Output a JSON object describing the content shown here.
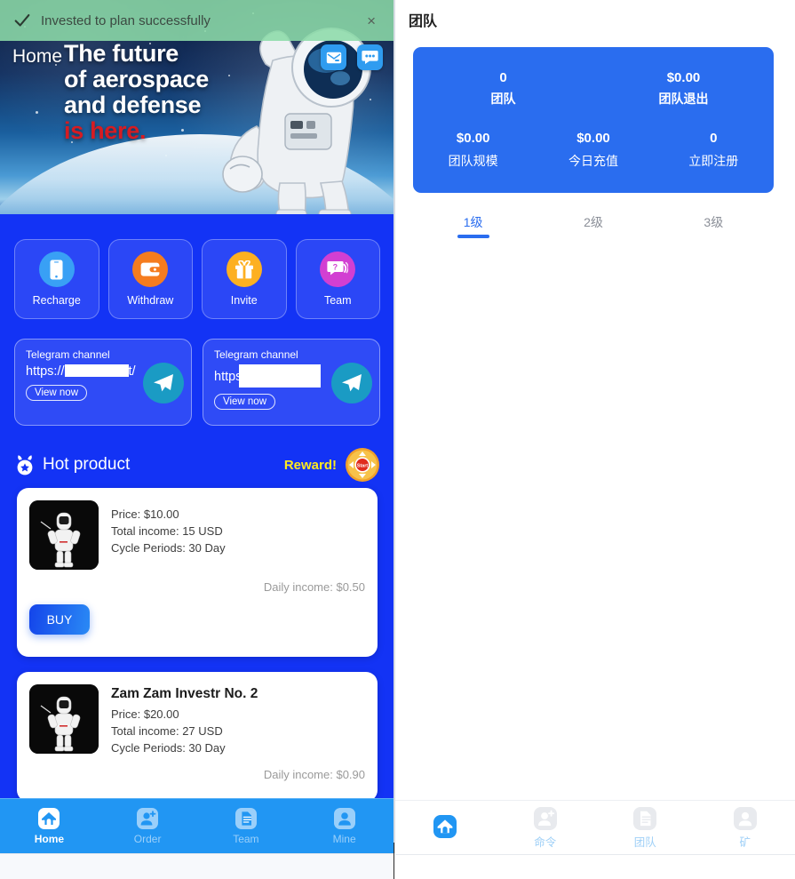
{
  "toast": {
    "message": "Invested to plan successfully",
    "close_label": "×",
    "check_icon": "check-icon",
    "bg_color": "#8cdba8"
  },
  "left": {
    "hero": {
      "home_label": "Home",
      "line1": "The future",
      "line2": "of aerospace",
      "line3": "and defense",
      "line4": "is here.",
      "accent_color": "#d61c22",
      "icons": [
        "mail-icon",
        "chat-icon"
      ]
    },
    "actions": [
      {
        "label": "Recharge",
        "icon": "phone-icon",
        "color": "#39a0f5"
      },
      {
        "label": "Withdraw",
        "icon": "wallet-icon",
        "color": "#f57c1f"
      },
      {
        "label": "Invite",
        "icon": "gift-icon",
        "color": "#fdb021"
      },
      {
        "label": "Team",
        "icon": "question-chat-icon",
        "color": "#d23fd2"
      }
    ],
    "telegram": [
      {
        "title": "Telegram channel",
        "url_prefix": "https://",
        "url_suffix": "t/",
        "button": "View now"
      },
      {
        "title": "Telegram channel",
        "url_prefix": "https",
        "url_suffix": "",
        "button": "View now"
      }
    ],
    "hot": {
      "title": "Hot product",
      "badge_icon": "medal-star-icon",
      "reward_label": "Reward!",
      "reward_color": "#ffeb1f",
      "wheel_label": "Start"
    },
    "products": [
      {
        "name": "",
        "price": "Price: $10.00",
        "total_income": "Total income: 15 USD",
        "cycle": "Cycle Periods: 30 Day",
        "daily": "Daily income: $0.50",
        "buy_label": "BUY"
      },
      {
        "name": "Zam Zam Investr No. 2",
        "price": "Price: $20.00",
        "total_income": "Total income: 27 USD",
        "cycle": "Cycle Periods: 30 Day",
        "daily": "Daily income: $0.90",
        "buy_label": ""
      }
    ],
    "nav": [
      {
        "label": "Home",
        "icon": "home-icon",
        "active": true
      },
      {
        "label": "Order",
        "icon": "user-plus-icon",
        "active": false
      },
      {
        "label": "Team",
        "icon": "document-icon",
        "active": false
      },
      {
        "label": "Mine",
        "icon": "user-icon",
        "active": false
      }
    ]
  },
  "right": {
    "title": "团队",
    "stats_card": {
      "bg_color": "#2a6def",
      "row1": [
        {
          "value": "0",
          "label": "团队"
        },
        {
          "value": "$0.00",
          "label": "团队退出"
        }
      ],
      "row2": [
        {
          "value": "$0.00",
          "label": "团队规模"
        },
        {
          "value": "$0.00",
          "label": "今日充值"
        },
        {
          "value": "0",
          "label": "立即注册"
        }
      ]
    },
    "tabs": [
      {
        "label": "1级",
        "active": true
      },
      {
        "label": "2级",
        "active": false
      },
      {
        "label": "3级",
        "active": false
      }
    ],
    "nav": [
      {
        "label": "",
        "icon": "home-icon",
        "active": true
      },
      {
        "label": "命令",
        "icon": "user-plus-icon",
        "active": false
      },
      {
        "label": "团队",
        "icon": "document-icon",
        "active": false
      },
      {
        "label": "矿",
        "icon": "user-icon",
        "active": false
      }
    ]
  }
}
